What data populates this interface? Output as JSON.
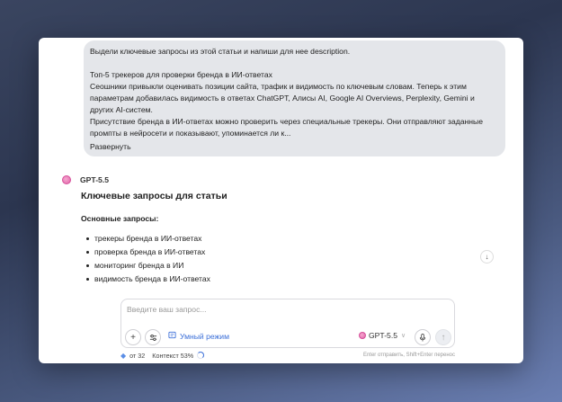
{
  "user_message": {
    "line1": "Выдели ключевые запросы из этой статьи и напиши для нее description.",
    "line2": "Топ-5 трекеров для проверки бренда в ИИ-ответах",
    "line3": "Сеошники привыкли оценивать позиции сайта, трафик и видимость по ключевым словам. Теперь к этим",
    "line4": "параметрам добавилась видимость в ответах ChatGPT, Алисы AI, Google AI Overviews, Perplexity, Gemini и",
    "line5": "других AI-систем.",
    "line6": "Присутствие бренда в ИИ-ответах можно проверить через специальные трекеры. Они отправляют заданные",
    "line7": "промпты в нейросети и показывают, упоминается ли к...",
    "expand_label": "Развернуть"
  },
  "assistant": {
    "model_name": "GPT-5.5",
    "title": "Ключевые запросы для статьи",
    "subtitle": "Основные запросы:",
    "items": [
      "трекеры бренда в ИИ-ответах",
      "проверка бренда в ИИ-ответах",
      "мониторинг бренда в ИИ",
      "видимость бренда в ИИ-ответах"
    ]
  },
  "composer": {
    "placeholder": "Введите ваш запрос...",
    "value": "",
    "smart_mode_label": "Умный режим",
    "model_label": "GPT-5.5"
  },
  "footer": {
    "balance": "от 32",
    "context": "Контекст 53%",
    "context_fraction": 0.53,
    "hint": "Enter отправить, Shift+Enter перенос"
  },
  "colors": {
    "accent": "#3b6fd8",
    "model_dot": "#e064a8",
    "bubble": "#e4e6ea"
  },
  "icons": {
    "attach": "plus-icon",
    "tools": "sliders-icon",
    "smart_mode": "smart-mode-icon",
    "mic": "mic-icon",
    "send": "arrow-up-icon",
    "scroll": "arrow-down-icon",
    "balance": "gem-icon"
  }
}
